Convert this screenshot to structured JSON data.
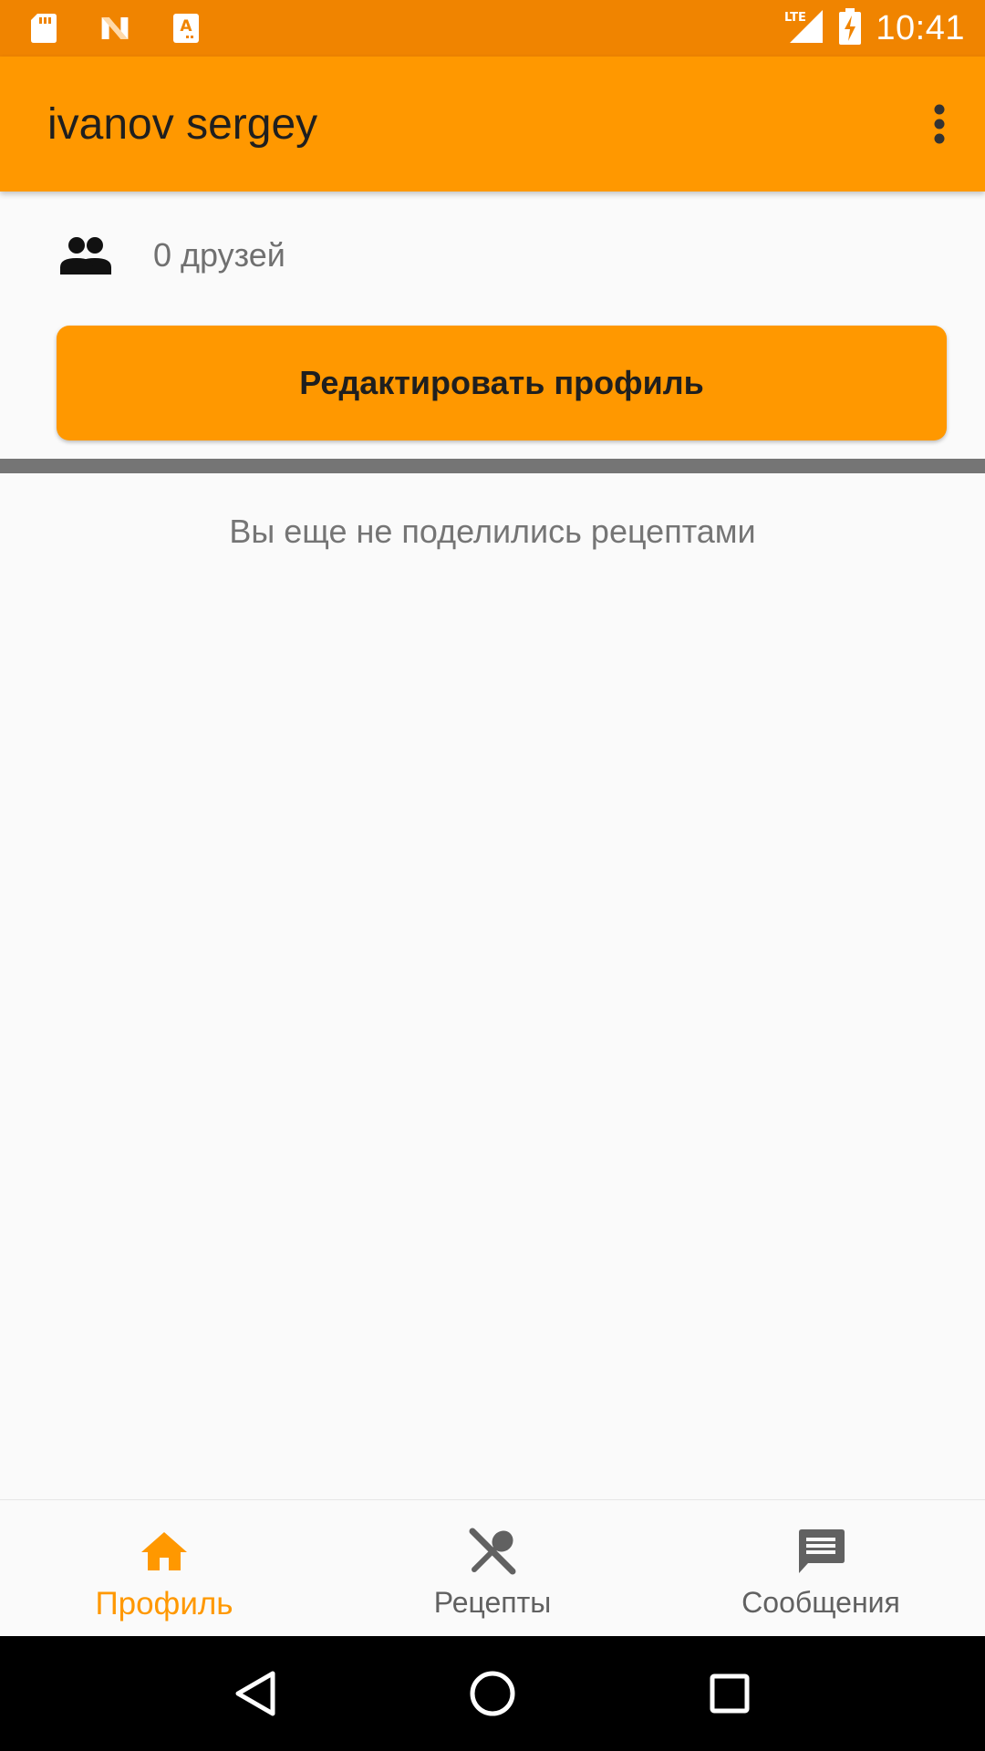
{
  "status_bar": {
    "time": "10:41",
    "network": "LTE",
    "icons": [
      "sd-card-icon",
      "n-notification-icon",
      "a-notification-icon",
      "lte-signal-icon",
      "battery-charging-icon"
    ]
  },
  "app_bar": {
    "title": "ivanov sergey",
    "overflow_icon": "more-vert-icon"
  },
  "profile": {
    "friends_icon": "people-icon",
    "friends_label": "0 друзей",
    "edit_button_label": "Редактировать профиль",
    "empty_recipes_message": "Вы еще не поделились рецептами"
  },
  "bottom_nav": {
    "items": [
      {
        "label": "Профиль",
        "icon": "home-icon",
        "active": true
      },
      {
        "label": "Рецепты",
        "icon": "restaurant-icon",
        "active": false
      },
      {
        "label": "Сообщения",
        "icon": "message-icon",
        "active": false
      }
    ]
  },
  "system_nav": {
    "buttons": [
      "back-icon",
      "home-circle-icon",
      "recents-icon"
    ]
  },
  "colors": {
    "status_bar": "#f08400",
    "primary": "#ff9800",
    "active_nav": "#ff9800",
    "divider": "#757575"
  }
}
